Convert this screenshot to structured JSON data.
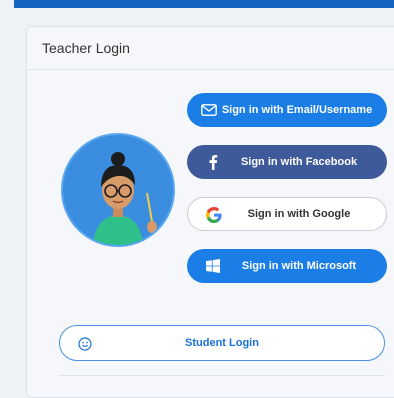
{
  "card": {
    "title": "Teacher Login"
  },
  "buttons": {
    "email": "Sign in with Email/Username",
    "facebook": "Sign in with Facebook",
    "google": "Sign in with Google",
    "microsoft": "Sign in with Microsoft"
  },
  "student": {
    "label": "Student Login"
  },
  "icons": {
    "email": "envelope-icon",
    "facebook": "facebook-icon",
    "google": "google-icon",
    "microsoft": "windows-icon",
    "student": "smiley-icon"
  },
  "colors": {
    "primary": "#1a7ee6",
    "facebook": "#3f5a9a",
    "topbar": "#1565c0",
    "avatar_bg": "#3b8de0"
  }
}
